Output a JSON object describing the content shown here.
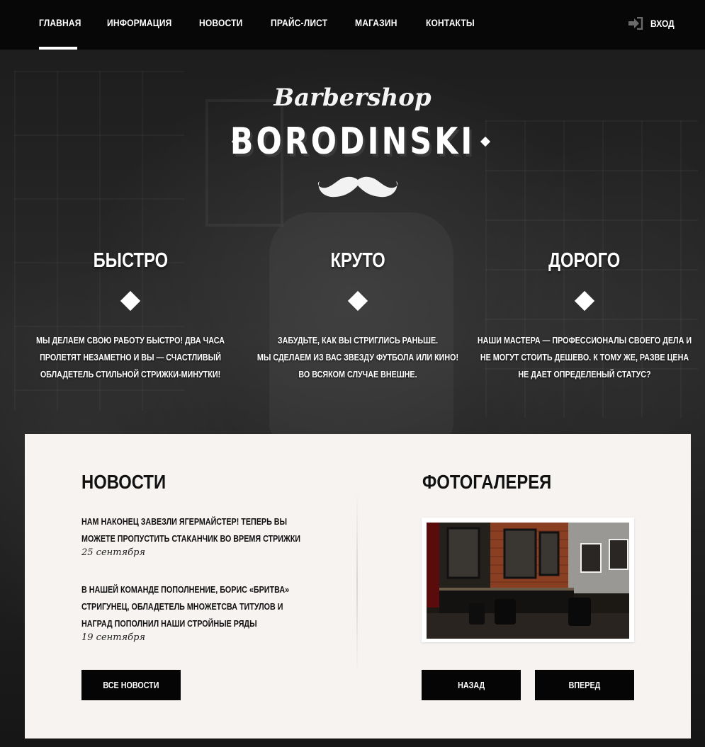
{
  "nav": {
    "items": [
      {
        "label": "ГЛАВНАЯ",
        "active": true
      },
      {
        "label": "ИНФОРМАЦИЯ",
        "active": false
      },
      {
        "label": "НОВОСТИ",
        "active": false
      },
      {
        "label": "ПРАЙС-ЛИСТ",
        "active": false
      },
      {
        "label": "МАГАЗИН",
        "active": false
      },
      {
        "label": "КОНТАКТЫ",
        "active": false
      }
    ],
    "login_label": "ВХОД",
    "login_icon": "sign-in-icon"
  },
  "logo": {
    "script": "Barbershop",
    "main": "BORODINSKI",
    "emblem": "mustache-icon"
  },
  "features": [
    {
      "title": "БЫСТРО",
      "lines": [
        "МЫ ДЕЛАЕМ СВОЮ РАБОТУ БЫСТРО! ДВА ЧАСА",
        "ПРОЛЕТЯТ НЕЗАМЕТНО И ВЫ — СЧАСТЛИВЫЙ",
        "ОБЛАДЕТЕЛЬ СТИЛЬНОЙ СТРИЖКИ-МИНУТКИ!"
      ]
    },
    {
      "title": "КРУТО",
      "lines": [
        "ЗАБУДЬТЕ, КАК ВЫ СТРИГЛИСЬ РАНЬШЕ.",
        "МЫ СДЕЛАЕМ ИЗ ВАС ЗВЕЗДУ ФУТБОЛА ИЛИ КИНО!",
        "ВО ВСЯКОМ СЛУЧАЕ ВНЕШНЕ."
      ]
    },
    {
      "title": "ДОРОГО",
      "lines": [
        "НАШИ МАСТЕРА — ПРОФЕССИОНАЛЫ СВОЕГО ДЕЛА И",
        "НЕ МОГУТ СТОИТЬ ДЕШЕВО. К ТОМУ ЖЕ, РАЗВЕ ЦЕНА",
        "НЕ ДАЕТ ОПРЕДЕЛЕНЫЙ СТАТУС?"
      ]
    }
  ],
  "news": {
    "title": "НОВОСТИ",
    "items": [
      {
        "lines": [
          "НАМ НАКОНЕЦ ЗАВЕЗЛИ ЯГЕРМАЙСТЕР! ТЕПЕРЬ ВЫ",
          "МОЖЕТЕ ПРОПУСТИТЬ СТАКАНЧИК ВО ВРЕМЯ СТРИЖКИ"
        ],
        "date": "25 сентября"
      },
      {
        "lines": [
          "В НАШЕЙ КОМАНДЕ ПОПОЛНЕНИЕ, БОРИС «БРИТВА»",
          "СТРИГУНЕЦ, ОБЛАДЕТЕЛЬ МНОЖЕТСВА ТИТУЛОВ И",
          "НАГРАД ПОПОЛНИЛ НАШИ СТРОЙНЫЕ РЯДЫ"
        ],
        "date": "19 сентября"
      }
    ],
    "all_button": "ВСЕ НОВОСТИ"
  },
  "gallery": {
    "title": "ФОТОГАЛЕРЕЯ",
    "prev_button": "НАЗАД",
    "next_button": "ВПЕРЕД"
  },
  "colors": {
    "nav_bg": "#070707",
    "panel_bg": "#f6f3f1",
    "button_bg": "#050505",
    "text_light": "#ffffff",
    "text_dark": "#111111"
  }
}
